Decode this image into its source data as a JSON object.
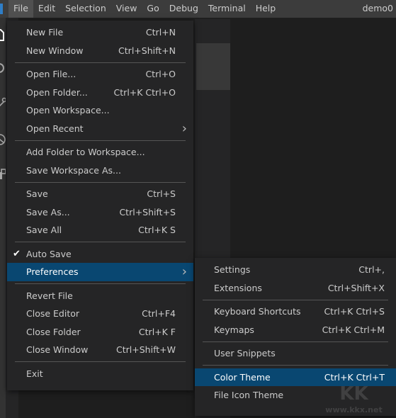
{
  "titlebar": {
    "menus": [
      "File",
      "Edit",
      "Selection",
      "View",
      "Go",
      "Debug",
      "Terminal",
      "Help"
    ],
    "active_menu": "File",
    "window_title": "demo0"
  },
  "activity_bar": {
    "icons": [
      "explorer-icon",
      "search-icon",
      "source-control-icon",
      "debug-icon",
      "extensions-icon"
    ]
  },
  "file_menu": {
    "groups": [
      [
        {
          "label": "New File",
          "shortcut": "Ctrl+N"
        },
        {
          "label": "New Window",
          "shortcut": "Ctrl+Shift+N"
        }
      ],
      [
        {
          "label": "Open File...",
          "shortcut": "Ctrl+O"
        },
        {
          "label": "Open Folder...",
          "shortcut": "Ctrl+K Ctrl+O"
        },
        {
          "label": "Open Workspace...",
          "shortcut": ""
        },
        {
          "label": "Open Recent",
          "shortcut": "",
          "submenu": true
        }
      ],
      [
        {
          "label": "Add Folder to Workspace...",
          "shortcut": ""
        },
        {
          "label": "Save Workspace As...",
          "shortcut": ""
        }
      ],
      [
        {
          "label": "Save",
          "shortcut": "Ctrl+S"
        },
        {
          "label": "Save As...",
          "shortcut": "Ctrl+Shift+S"
        },
        {
          "label": "Save All",
          "shortcut": "Ctrl+K S"
        }
      ],
      [
        {
          "label": "Auto Save",
          "shortcut": "",
          "checked": true
        },
        {
          "label": "Preferences",
          "shortcut": "",
          "submenu": true,
          "selected": true
        }
      ],
      [
        {
          "label": "Revert File",
          "shortcut": ""
        },
        {
          "label": "Close Editor",
          "shortcut": "Ctrl+F4"
        },
        {
          "label": "Close Folder",
          "shortcut": "Ctrl+K F"
        },
        {
          "label": "Close Window",
          "shortcut": "Ctrl+Shift+W"
        }
      ],
      [
        {
          "label": "Exit",
          "shortcut": ""
        }
      ]
    ]
  },
  "preferences_menu": {
    "groups": [
      [
        {
          "label": "Settings",
          "shortcut": "Ctrl+,"
        },
        {
          "label": "Extensions",
          "shortcut": "Ctrl+Shift+X"
        }
      ],
      [
        {
          "label": "Keyboard Shortcuts",
          "shortcut": "Ctrl+K Ctrl+S"
        },
        {
          "label": "Keymaps",
          "shortcut": "Ctrl+K Ctrl+M"
        }
      ],
      [
        {
          "label": "User Snippets",
          "shortcut": ""
        }
      ],
      [
        {
          "label": "Color Theme",
          "shortcut": "Ctrl+K Ctrl+T",
          "selected": true
        },
        {
          "label": "File Icon Theme",
          "shortcut": ""
        }
      ]
    ]
  },
  "watermark": "www.kkx.net",
  "colors": {
    "selection": "#094771",
    "menu_bg": "#252526",
    "titlebar_bg": "#3c3c3c"
  }
}
